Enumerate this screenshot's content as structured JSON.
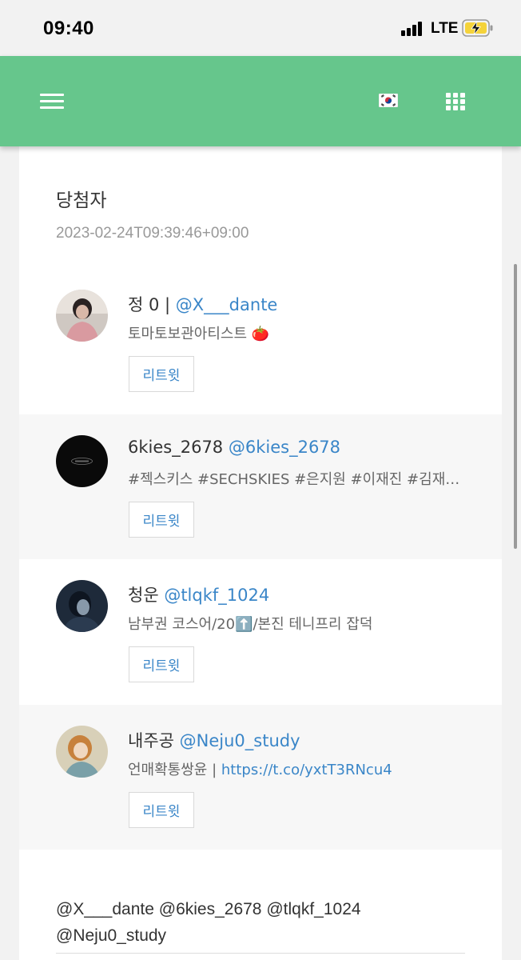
{
  "status_bar": {
    "time": "09:40",
    "network": "LTE"
  },
  "nav": {
    "menu_icon": "hamburger-menu-icon",
    "language_flag_icon": "korea-flag-icon",
    "apps_icon": "apps-grid-icon"
  },
  "card": {
    "title": "당첨자",
    "date": "2023-02-24T09:39:46+09:00",
    "winners": [
      {
        "name": "정 0 |",
        "handle": "@X___dante",
        "bio": "토마토보관아티스트 🍅",
        "bio_link": "",
        "button": "리트윗"
      },
      {
        "name": "6kies_2678",
        "handle": "@6kies_2678",
        "bio": "#젝스키스 #SECHSKIES #은지원 #이재진 #김재덕 #강성훈",
        "bio_link": "",
        "button": "리트윗"
      },
      {
        "name": "청운",
        "handle": "@tlqkf_1024",
        "bio": "남부권 코스어/20⬆️/본진 테니프리 잡덕",
        "bio_link": "",
        "button": "리트윗"
      },
      {
        "name": "내주공",
        "handle": "@Neju0_study",
        "bio": "언매확통쌍윤 | ",
        "bio_link": "https://t.co/yxtT3RNcu4",
        "button": "리트윗"
      }
    ],
    "mentions": "@X___dante @6kies_2678 @tlqkf_1024 @Neju0_study"
  },
  "colors": {
    "nav_green": "#66c68c",
    "link_blue": "#3a86c8",
    "muted_text": "#999999"
  }
}
